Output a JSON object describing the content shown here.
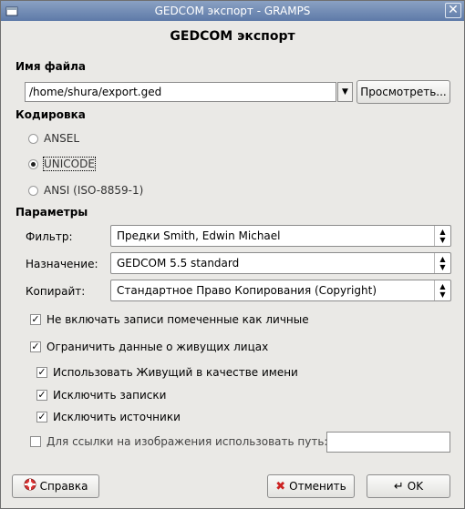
{
  "window": {
    "title": "GEDCOM экспорт - GRAMPS"
  },
  "heading": "GEDCOM экспорт",
  "file": {
    "section_label": "Имя файла",
    "path": "/home/shura/export.ged",
    "browse_label": "Просмотреть..."
  },
  "encoding": {
    "section_label": "Кодировка",
    "options": [
      {
        "label": "ANSEL",
        "selected": false
      },
      {
        "label": "UNICODE",
        "selected": true
      },
      {
        "label": "ANSI (ISO-8859-1)",
        "selected": false
      }
    ]
  },
  "params": {
    "section_label": "Параметры",
    "filter_label": "Фильтр:",
    "filter_value": "Предки Smith, Edwin Michael",
    "target_label": "Назначение:",
    "target_value": "GEDCOM 5.5 standard",
    "copyright_label": "Копирайт:",
    "copyright_value": "Стандартное Право Копирования (Copyright)"
  },
  "checks": [
    {
      "label": "Не включать записи помеченные как личные",
      "checked": true
    },
    {
      "label": "Ограничить данные о живущих лицах",
      "checked": true
    },
    {
      "label": "Использовать Живущий в качестве имени",
      "checked": true
    },
    {
      "label": "Исключить записки",
      "checked": true
    },
    {
      "label": "Исключить источники",
      "checked": true
    },
    {
      "label": "Для ссылки на изображения использовать путь:",
      "checked": false
    }
  ],
  "image_path": "",
  "buttons": {
    "help": "Справка",
    "cancel": "Отменить",
    "ok": "OK"
  }
}
